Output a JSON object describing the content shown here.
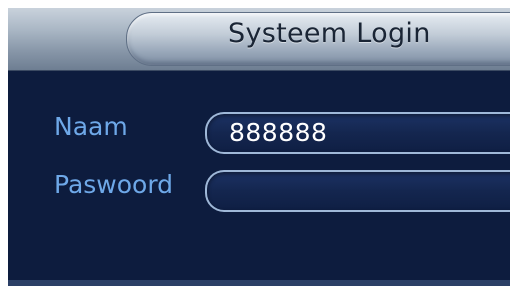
{
  "dialog": {
    "title": "Systeem Login"
  },
  "form": {
    "username_label": "Naam",
    "username_value": "888888",
    "password_label": "Paswoord",
    "password_value": ""
  }
}
